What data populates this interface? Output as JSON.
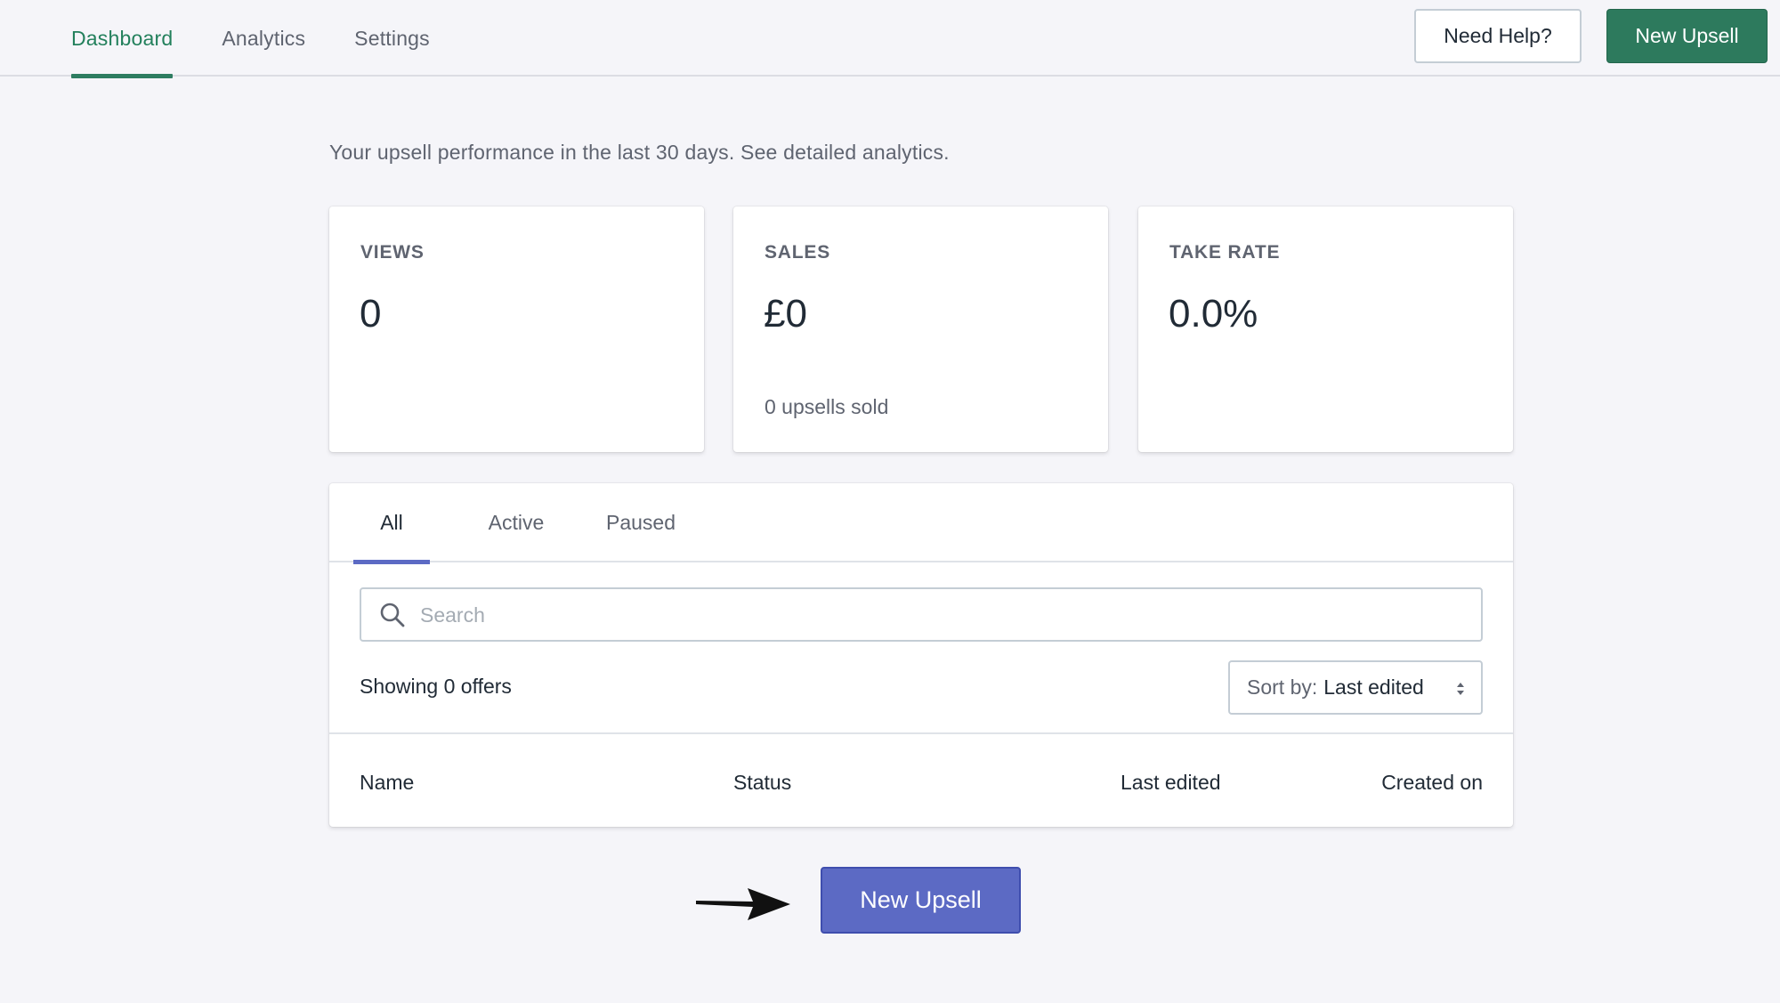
{
  "nav": {
    "tabs": [
      "Dashboard",
      "Analytics",
      "Settings"
    ],
    "active_tab": "Dashboard",
    "help_button": "Need Help?",
    "new_upsell_button": "New Upsell"
  },
  "intro": "Your upsell performance in the last 30 days. See detailed analytics.",
  "stats": {
    "views": {
      "label": "VIEWS",
      "value": "0"
    },
    "sales": {
      "label": "SALES",
      "value": "£0",
      "sub": "0 upsells sold"
    },
    "take_rate": {
      "label": "TAKE RATE",
      "value": "0.0%"
    }
  },
  "offers": {
    "tabs": [
      "All",
      "Active",
      "Paused"
    ],
    "active_tab": "All",
    "search_placeholder": "Search",
    "search_value": "",
    "showing": "Showing 0 offers",
    "sort_label": "Sort by:",
    "sort_value": "Last edited",
    "columns": [
      "Name",
      "Status",
      "Last edited",
      "Created on"
    ],
    "rows": []
  },
  "cta": {
    "new_upsell_button": "New Upsell"
  },
  "colors": {
    "brand_green": "#2d7a5d",
    "accent_indigo": "#5c6ac4",
    "background": "#f5f5f9"
  }
}
